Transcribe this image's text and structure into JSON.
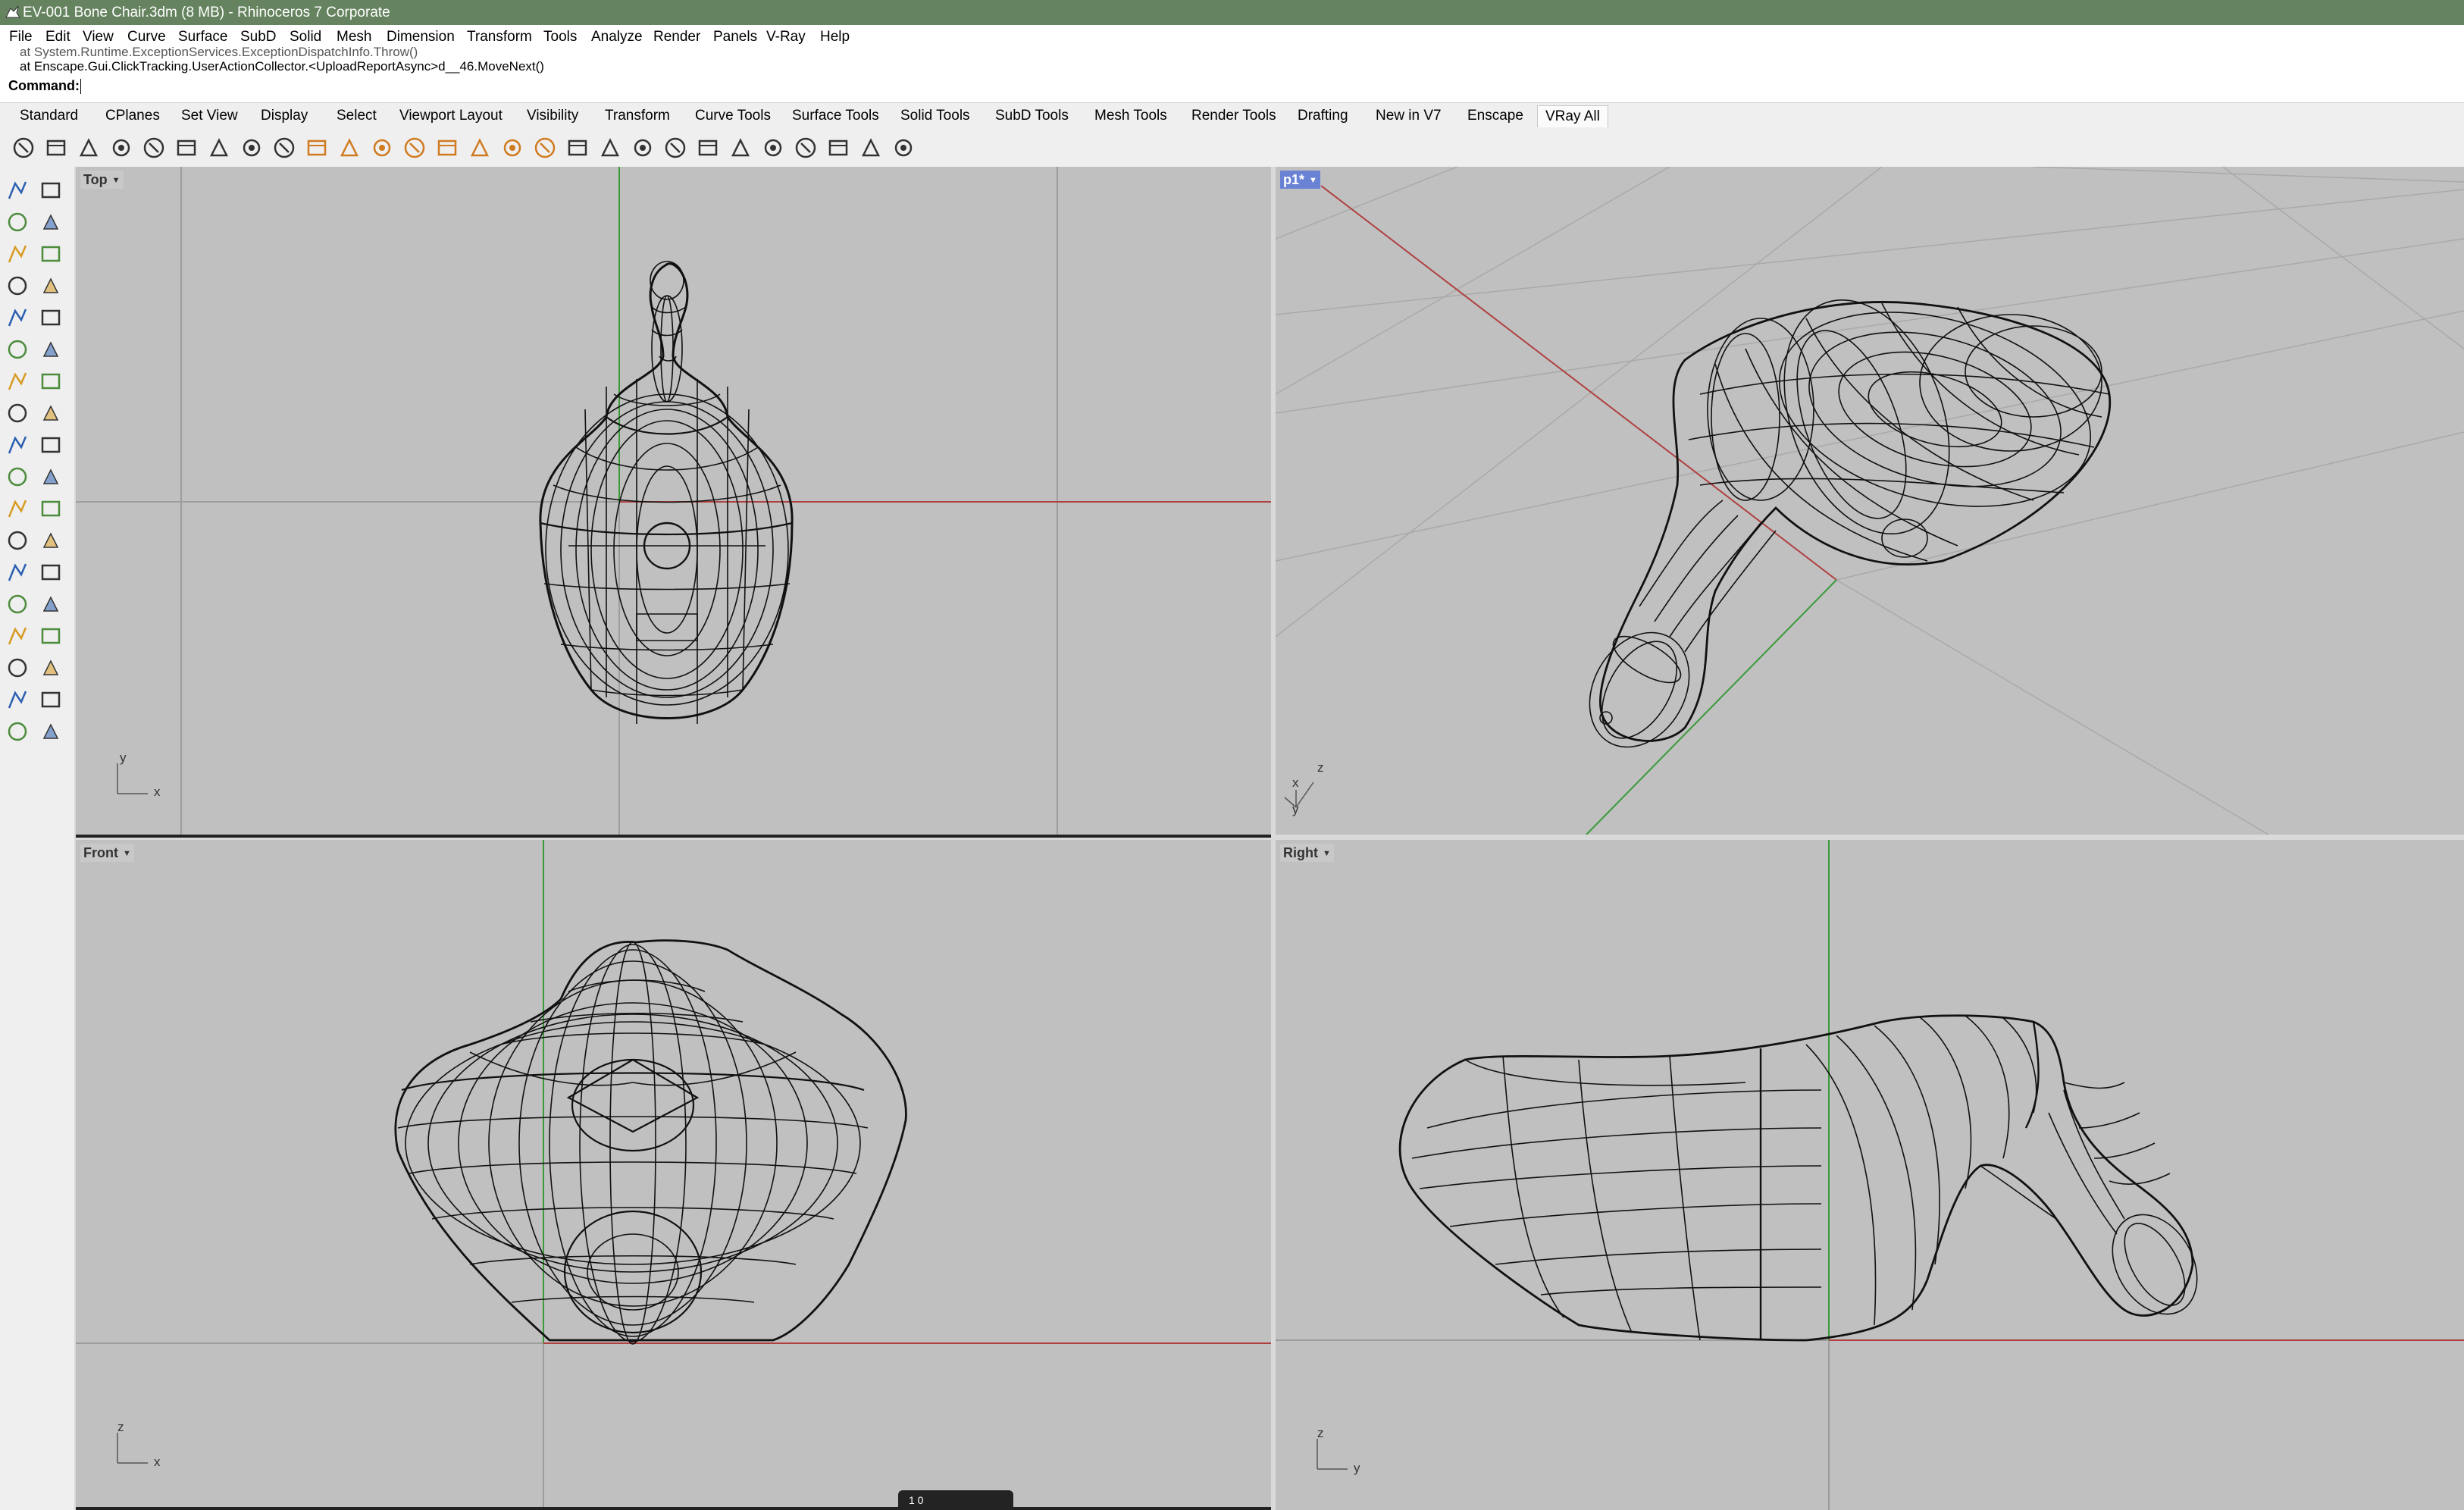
{
  "window": {
    "title": "EV-001 Bone Chair.3dm (8 MB) - Rhinoceros 7 Corporate"
  },
  "menu": [
    "File",
    "Edit",
    "View",
    "Curve",
    "Surface",
    "SubD",
    "Solid",
    "Mesh",
    "Dimension",
    "Transform",
    "Tools",
    "Analyze",
    "Render",
    "Panels",
    "V-Ray",
    "Help"
  ],
  "command": {
    "history": [
      "at System.Runtime.ExceptionServices.ExceptionDispatchInfo.Throw()",
      "at Enscape.Gui.ClickTracking.UserActionCollector.<UploadReportAsync>d__46.MoveNext()"
    ],
    "prompt": "Command:",
    "value": ""
  },
  "tabs": {
    "items": [
      "Standard",
      "CPlanes",
      "Set View",
      "Display",
      "Select",
      "Viewport Layout",
      "Visibility",
      "Transform",
      "Curve Tools",
      "Surface Tools",
      "Solid Tools",
      "SubD Tools",
      "Mesh Tools",
      "Render Tools",
      "Drafting",
      "New in V7",
      "Enscape",
      "VRay All"
    ],
    "active": "VRay All"
  },
  "toolbar_icons": [
    "vray-render-icon",
    "vray-interactive-icon",
    "vray-teapot-icon",
    "vray-lights-icon",
    "vray-refresh-icon",
    "vray-frame-buffer-icon",
    "vray-asset-editor-icon",
    "vray-vfb-icon",
    "vray-camera-icon",
    "vray-spotlight-icon",
    "vray-sphere-light-icon",
    "vray-ies-light-icon",
    "vray-rect-light-icon",
    "vray-sun-icon",
    "vray-dome-light-icon",
    "vray-omni-light-icon",
    "vray-mesh-light-icon",
    "vray-infinite-plane-icon",
    "vray-proxy-icon",
    "vray-fur-icon",
    "vray-scatter-icon",
    "vray-decal-icon",
    "vray-clipper-icon",
    "vray-mesh-export-icon",
    "vray-material-icon",
    "vray-globe-icon",
    "vray-pin-icon",
    "vray-lock-icon"
  ],
  "sidebar_icons": [
    "select-arrow-icon",
    "point-icon",
    "polyline-icon",
    "curve-icon",
    "circle-icon",
    "ellipse-icon",
    "arc-icon",
    "rectangle-icon",
    "polygon-icon",
    "fillet-curve-icon",
    "surface-icon",
    "loft-icon",
    "box-icon",
    "sphere-icon",
    "cylinder-icon",
    "extrude-icon",
    "boolean-icon",
    "split-icon",
    "trim-icon",
    "join-icon",
    "explode-icon",
    "group-icon",
    "offset-icon",
    "move-icon",
    "text-icon",
    "dimension-icon",
    "array-icon",
    "scale-icon",
    "block-icon",
    "layer-icon",
    "grid-icon",
    "analyze-icon",
    "properties-icon",
    "check-icon",
    "render-icon",
    "light-icon"
  ],
  "viewports": [
    {
      "name": "Top",
      "axes": [
        "y",
        "x"
      ],
      "active": false
    },
    {
      "name": "p1*",
      "axes": [
        "x",
        "z",
        "y"
      ],
      "active": true
    },
    {
      "name": "Front",
      "axes": [
        "z",
        "x"
      ],
      "active": false
    },
    {
      "name": "Right",
      "axes": [
        "z",
        "y"
      ],
      "active": false
    }
  ],
  "colors": {
    "titlebar": "#65835f",
    "viewport_bg": "#c0c0c0",
    "grid": "#9d9d9d",
    "x_axis": "#b04040",
    "y_axis": "#3a9a3a",
    "wire": "#111111",
    "active_label": "#6a82d4"
  },
  "tooltip": {
    "text": "1 0"
  }
}
